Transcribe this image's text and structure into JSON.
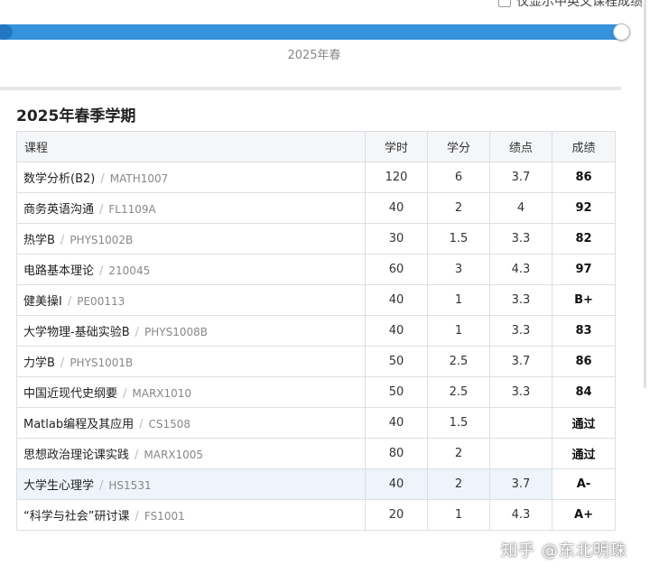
{
  "top_option": {
    "label": "仅显示中英文课程成绩"
  },
  "slider": {
    "label": "2025年春",
    "progress": 1.0
  },
  "semester": {
    "title": "2025年春季学期"
  },
  "table": {
    "headers": {
      "course": "课程",
      "hours": "学时",
      "credits": "学分",
      "gpa": "绩点",
      "grade": "成绩"
    },
    "rows": [
      {
        "name": "数学分析(B2)",
        "code": "MATH1007",
        "hours": "120",
        "credits": "6",
        "gpa": "3.7",
        "grade": "86"
      },
      {
        "name": "商务英语沟通",
        "code": "FL1109A",
        "hours": "40",
        "credits": "2",
        "gpa": "4",
        "grade": "92"
      },
      {
        "name": "热学B",
        "code": "PHYS1002B",
        "hours": "30",
        "credits": "1.5",
        "gpa": "3.3",
        "grade": "82"
      },
      {
        "name": "电路基本理论",
        "code": "210045",
        "hours": "60",
        "credits": "3",
        "gpa": "4.3",
        "grade": "97"
      },
      {
        "name": "健美操I",
        "code": "PE00113",
        "hours": "40",
        "credits": "1",
        "gpa": "3.3",
        "grade": "B+"
      },
      {
        "name": "大学物理-基础实验B",
        "code": "PHYS1008B",
        "hours": "40",
        "credits": "1",
        "gpa": "3.3",
        "grade": "83"
      },
      {
        "name": "力学B",
        "code": "PHYS1001B",
        "hours": "50",
        "credits": "2.5",
        "gpa": "3.7",
        "grade": "86"
      },
      {
        "name": "中国近现代史纲要",
        "code": "MARX1010",
        "hours": "50",
        "credits": "2.5",
        "gpa": "3.3",
        "grade": "84"
      },
      {
        "name": "Matlab编程及其应用",
        "code": "CS1508",
        "hours": "40",
        "credits": "1.5",
        "gpa": "",
        "grade": "通过"
      },
      {
        "name": "思想政治理论课实践",
        "code": "MARX1005",
        "hours": "80",
        "credits": "2",
        "gpa": "",
        "grade": "通过"
      },
      {
        "name": "大学生心理学",
        "code": "HS1531",
        "hours": "40",
        "credits": "2",
        "gpa": "3.7",
        "grade": "A-"
      },
      {
        "name": "“科学与社会”研讨课",
        "code": "FS1001",
        "hours": "20",
        "credits": "1",
        "gpa": "4.3",
        "grade": "A+"
      }
    ],
    "highlighted_row": 10
  },
  "watermark": {
    "text": "知乎 @东北明珠"
  },
  "colors": {
    "accent": "#3592db",
    "header_bg": "#f4f6f8",
    "border": "#dcdfe3"
  }
}
